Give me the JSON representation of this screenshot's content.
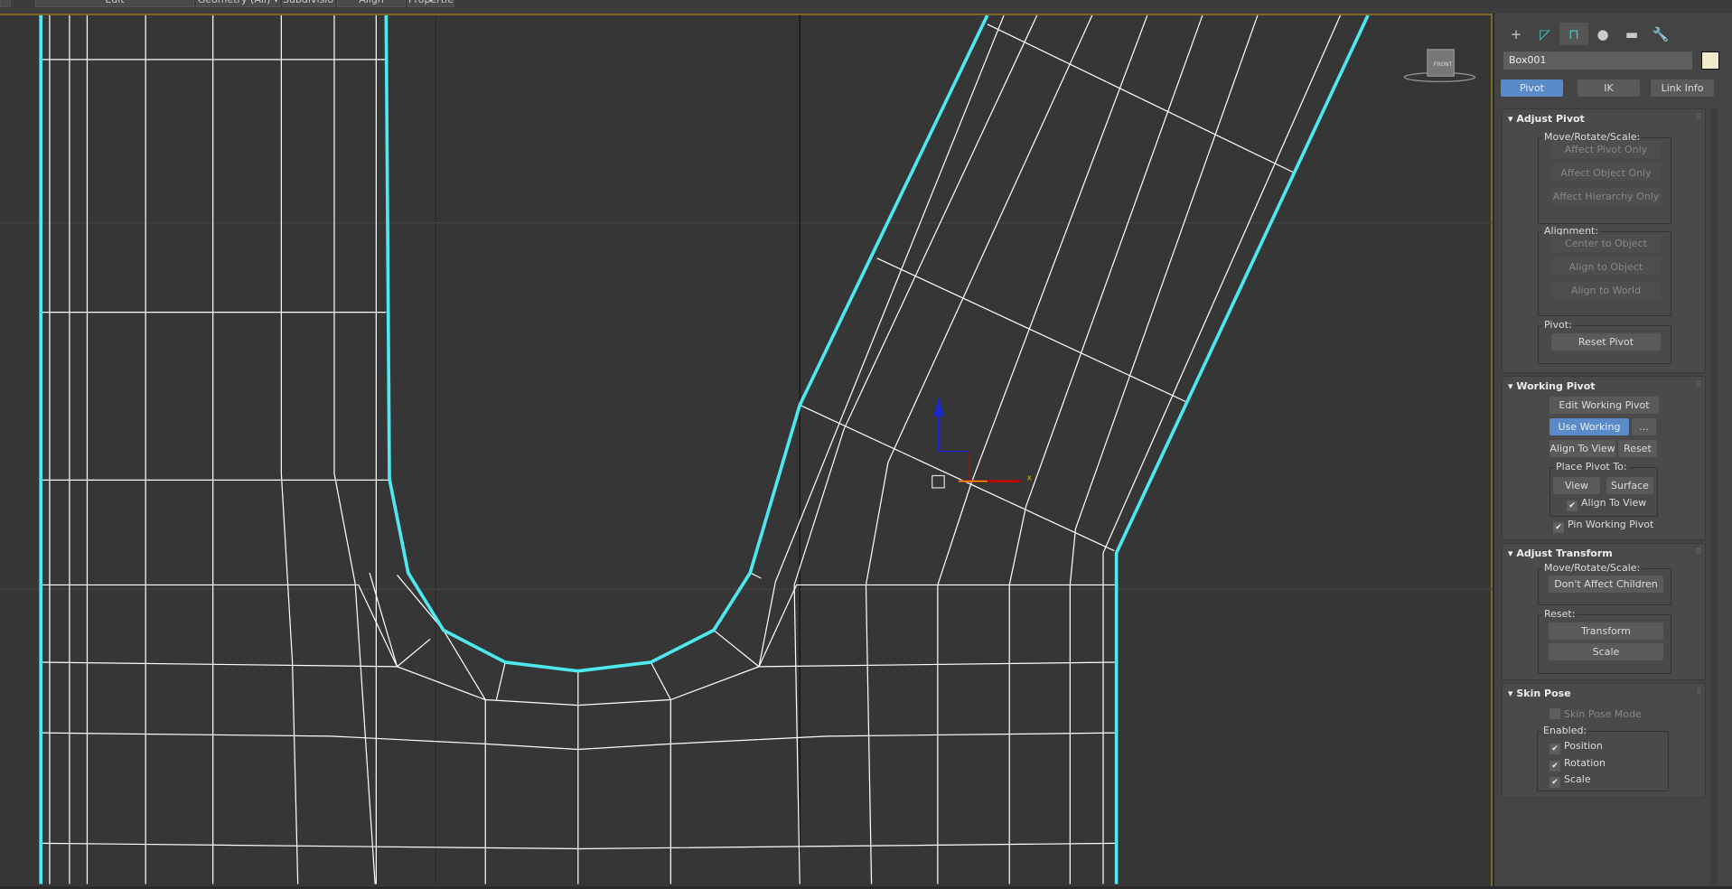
{
  "toolbar": {
    "items": [
      "Edit",
      "Geometry (All) ▾",
      "Subdivision",
      "Align",
      "Properties ▾"
    ]
  },
  "viewport": {
    "label": "Front",
    "gizmo_axis_x": "x",
    "gizmo_axis_y": "z",
    "colors": {
      "selection": "#4de8f0",
      "wire": "#ffffff",
      "bg": "#363636"
    }
  },
  "panel": {
    "tabs": [
      "create-icon",
      "modify-icon",
      "hierarchy-icon",
      "motion-icon",
      "display-icon",
      "utilities-icon"
    ],
    "object_name": "Box001",
    "object_color": "#f2ebcb",
    "modes": [
      "Pivot",
      "IK",
      "Link Info"
    ],
    "adjust_pivot": {
      "title": "Adjust Pivot",
      "mrs_label": "Move/Rotate/Scale:",
      "mrs": [
        "Affect Pivot Only",
        "Affect Object Only",
        "Affect Hierarchy Only"
      ],
      "alignment_label": "Alignment:",
      "alignment": [
        "Center to Object",
        "Align to Object",
        "Align to World"
      ],
      "pivot_label": "Pivot:",
      "reset_pivot": "Reset Pivot"
    },
    "working_pivot": {
      "title": "Working Pivot",
      "edit": "Edit Working Pivot",
      "use": "Use Working Pivot",
      "more": "...",
      "align_to_view": "Align To View",
      "reset": "Reset",
      "place_label": "Place Pivot To:",
      "view": "View",
      "surface": "Surface",
      "align_cb": "Align To View",
      "pin_cb": "Pin Working Pivot"
    },
    "adjust_transform": {
      "title": "Adjust Transform",
      "mrs_label": "Move/Rotate/Scale:",
      "dont_affect": "Don't Affect Children",
      "reset_label": "Reset:",
      "transform": "Transform",
      "scale": "Scale"
    },
    "skin_pose": {
      "title": "Skin Pose",
      "mode": "Skin Pose Mode",
      "enabled_label": "Enabled:",
      "position": "Position",
      "rotation": "Rotation",
      "scale": "Scale"
    }
  }
}
